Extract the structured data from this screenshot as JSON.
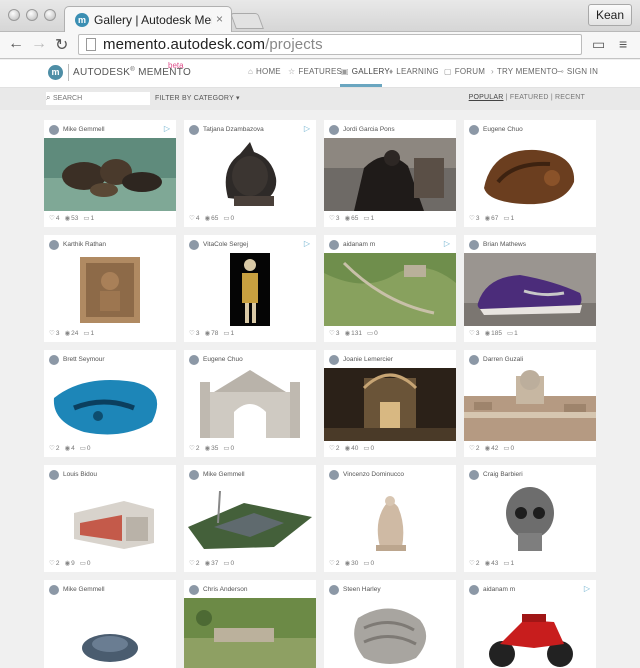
{
  "browser": {
    "tab_title": "Gallery | Autodesk Memento",
    "tab_close": "×",
    "profile": "Kean",
    "back": "←",
    "forward": "→",
    "reload": "↻",
    "url_host": "memento.autodesk.com",
    "url_path": "/projects"
  },
  "site": {
    "brand": "AUTODESK",
    "product": "MEMENTO",
    "beta": "beta",
    "nav": [
      {
        "label": "HOME",
        "icon": "⌂"
      },
      {
        "label": "FEATURES",
        "icon": "☆"
      },
      {
        "label": "GALLERY",
        "icon": "▣"
      },
      {
        "label": "LEARNING",
        "icon": "♦"
      },
      {
        "label": "FORUM",
        "icon": "▢"
      },
      {
        "label": "TRY MEMENTO",
        "icon": "›"
      },
      {
        "label": "SIGN IN",
        "icon": "⊸"
      }
    ],
    "active_nav": "GALLERY"
  },
  "filters": {
    "search_placeholder": "SEARCH",
    "category": "FILTER BY CATEGORY ▾",
    "sort": {
      "popular": "POPULAR",
      "featured": "FEATURED",
      "recent": "RECENT",
      "sep": "|"
    }
  },
  "cards": [
    {
      "author": "Mike Gemmell",
      "video": true,
      "likes": "4",
      "views": "53",
      "comments": "1",
      "thumb": "rocks"
    },
    {
      "author": "Tatjana Dzambazova",
      "video": true,
      "likes": "4",
      "views": "65",
      "comments": "0",
      "thumb": "horse"
    },
    {
      "author": "Jordi Garcia Pons",
      "video": false,
      "likes": "3",
      "views": "65",
      "comments": "1",
      "thumb": "statue-dark"
    },
    {
      "author": "Eugene Chuo",
      "video": false,
      "likes": "3",
      "views": "67",
      "comments": "1",
      "thumb": "wood"
    },
    {
      "author": "Karthik Rathan",
      "video": false,
      "likes": "3",
      "views": "24",
      "comments": "1",
      "thumb": "relief"
    },
    {
      "author": "VitaCole Sergej",
      "video": true,
      "likes": "3",
      "views": "78",
      "comments": "1",
      "thumb": "skeleton"
    },
    {
      "author": "aidanam m",
      "video": true,
      "likes": "3",
      "views": "131",
      "comments": "0",
      "thumb": "terrain"
    },
    {
      "author": "Brian Mathews",
      "video": false,
      "likes": "3",
      "views": "185",
      "comments": "1",
      "thumb": "shoe"
    },
    {
      "author": "Brett Seymour",
      "video": false,
      "likes": "2",
      "views": "4",
      "comments": "0",
      "thumb": "reef"
    },
    {
      "author": "Eugene Chuo",
      "video": false,
      "likes": "2",
      "views": "35",
      "comments": "0",
      "thumb": "gate"
    },
    {
      "author": "Joanie Lemercier",
      "video": false,
      "likes": "2",
      "views": "40",
      "comments": "0",
      "thumb": "church"
    },
    {
      "author": "Darren Guzali",
      "video": false,
      "likes": "2",
      "views": "42",
      "comments": "0",
      "thumb": "city"
    },
    {
      "author": "Louis Bidou",
      "video": false,
      "likes": "2",
      "views": "9",
      "comments": "0",
      "thumb": "building"
    },
    {
      "author": "Mike Gemmell",
      "video": false,
      "likes": "2",
      "views": "37",
      "comments": "0",
      "thumb": "site"
    },
    {
      "author": "Vincenzo Dominucco",
      "video": false,
      "likes": "2",
      "views": "30",
      "comments": "0",
      "thumb": "sculpture"
    },
    {
      "author": "Craig Barbieri",
      "video": false,
      "likes": "2",
      "views": "43",
      "comments": "1",
      "thumb": "skull"
    },
    {
      "author": "Mike Gemmell",
      "video": false,
      "likes": "",
      "views": "",
      "comments": "",
      "thumb": "stone"
    },
    {
      "author": "Chris Anderson",
      "video": false,
      "likes": "",
      "views": "",
      "comments": "",
      "thumb": "aerial"
    },
    {
      "author": "Steen Harley",
      "video": false,
      "likes": "",
      "views": "",
      "comments": "",
      "thumb": "tube"
    },
    {
      "author": "aidanam m",
      "video": true,
      "likes": "",
      "views": "",
      "comments": "",
      "thumb": "motorbike"
    }
  ],
  "icons": {
    "like": "heart-icon",
    "view": "eye-icon",
    "comment": "comment-icon",
    "video": "play-icon"
  },
  "colors": {
    "accent": "#6aa6c0",
    "beta": "#e0508c",
    "logo": "#4e8ea6"
  }
}
